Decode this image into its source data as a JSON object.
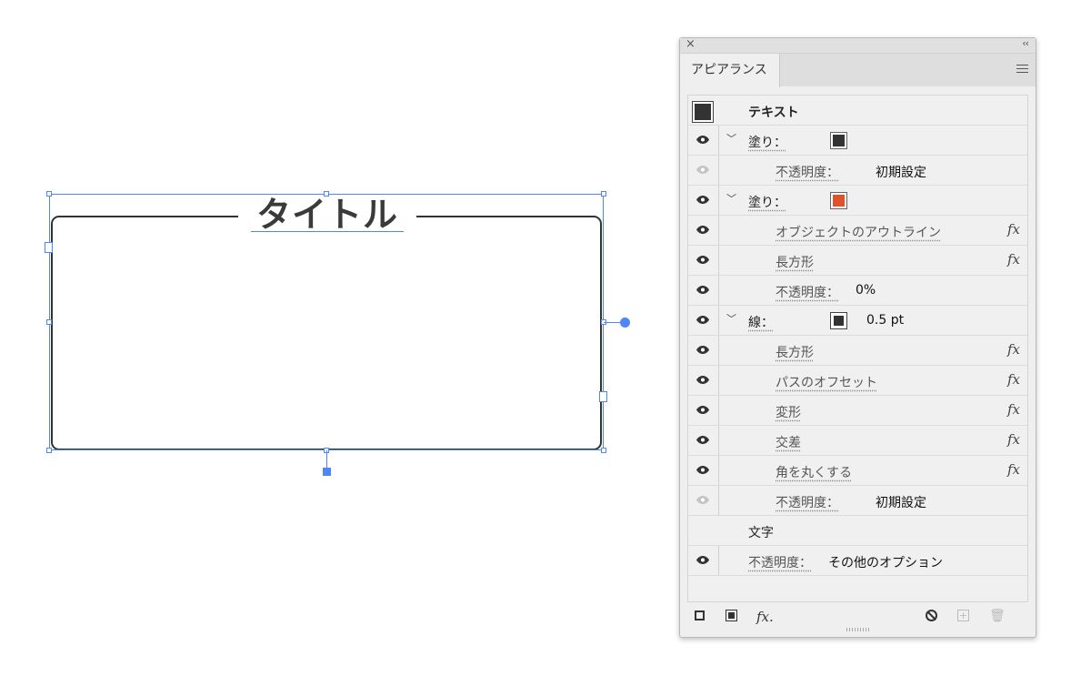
{
  "canvas": {
    "title_text": "タイトル"
  },
  "panel": {
    "tab_label": "アピアランス",
    "close_glyph": "×",
    "collapse_glyph": "‹‹",
    "rows": [
      {
        "label": "テキスト"
      },
      {
        "label": "塗り：",
        "swatch_color": "#333333"
      },
      {
        "label": "不透明度：",
        "value": "初期設定"
      },
      {
        "label": "塗り：",
        "swatch_color": "#e0522a"
      },
      {
        "label": "オブジェクトのアウトライン",
        "fx": "fx"
      },
      {
        "label": "長方形",
        "fx": "fx"
      },
      {
        "label": "不透明度：",
        "value": "0%"
      },
      {
        "label": "線：",
        "swatch_color": "#333333",
        "value": "0.5 pt"
      },
      {
        "label": "長方形",
        "fx": "fx"
      },
      {
        "label": "パスのオフセット",
        "fx": "fx"
      },
      {
        "label": "変形",
        "fx": "fx"
      },
      {
        "label": "交差",
        "fx": "fx"
      },
      {
        "label": "角を丸くする",
        "fx": "fx"
      },
      {
        "label": "不透明度：",
        "value": "初期設定"
      },
      {
        "label": "文字"
      },
      {
        "label": "不透明度：",
        "value": "その他のオプション"
      }
    ],
    "bottom": {
      "fx_label": "fx."
    }
  }
}
